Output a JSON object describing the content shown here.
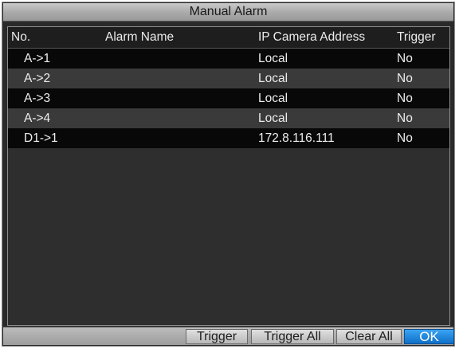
{
  "window": {
    "title": "Manual Alarm"
  },
  "table": {
    "columns": [
      "No.",
      "Alarm Name",
      "IP Camera Address",
      "Trigger"
    ],
    "rows": [
      {
        "no": "A->1",
        "alarm_name": "",
        "ip_camera_address": "Local",
        "trigger": "No"
      },
      {
        "no": "A->2",
        "alarm_name": "",
        "ip_camera_address": "Local",
        "trigger": "No"
      },
      {
        "no": "A->3",
        "alarm_name": "",
        "ip_camera_address": "Local",
        "trigger": "No"
      },
      {
        "no": "A->4",
        "alarm_name": "",
        "ip_camera_address": "Local",
        "trigger": "No"
      },
      {
        "no": "D1->1",
        "alarm_name": "",
        "ip_camera_address": "172.8.116.111",
        "trigger": "No"
      }
    ]
  },
  "buttons": {
    "trigger": "Trigger",
    "trigger_all": "Trigger All",
    "clear_all": "Clear All",
    "ok": "OK"
  },
  "colors": {
    "selected_button": "#1e88e5",
    "row_dark": "#080808",
    "row_light": "#3a3a3a"
  }
}
